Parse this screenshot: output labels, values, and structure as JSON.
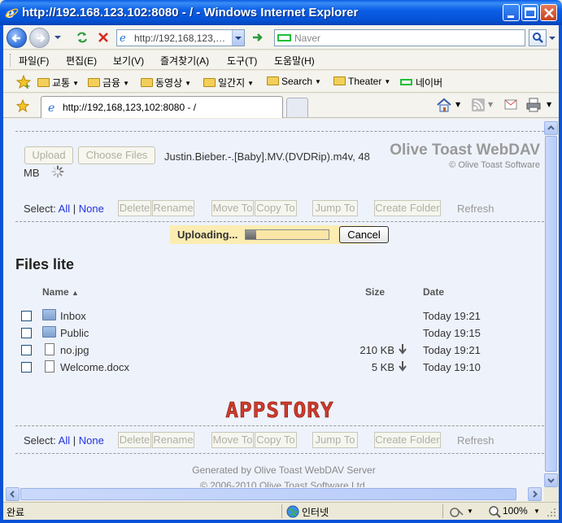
{
  "window": {
    "title": "http://192.168.123.102:8080 - / - Windows Internet Explorer"
  },
  "navbar": {
    "address": "http://192,168,123,…",
    "search_placeholder": "Naver"
  },
  "menu": {
    "items": [
      "파일(F)",
      "편집(E)",
      "보기(V)",
      "즐겨찾기(A)",
      "도구(T)",
      "도움말(H)"
    ]
  },
  "favorites": {
    "items": [
      {
        "label": "교통",
        "icon": "folder-icon"
      },
      {
        "label": "금융",
        "icon": "folder-icon"
      },
      {
        "label": "동영상",
        "icon": "folder-icon"
      },
      {
        "label": "일간지",
        "icon": "folder-icon"
      },
      {
        "label": "Search",
        "icon": "folder-icon"
      },
      {
        "label": "Theater",
        "icon": "folder-icon"
      },
      {
        "label": "네이버",
        "icon": "naver-icon"
      }
    ]
  },
  "tab": {
    "title": "http://192,168,123,102:8080 - /"
  },
  "page": {
    "upload_label": "Upload",
    "choose_files_label": "Choose Files",
    "selected_file_line1": "Justin.Bieber.-.[Baby].MV.(DVDRip).m4v, 48",
    "selected_file_line2": "MB",
    "brand": "Olive Toast WebDAV",
    "brand_sub": "© Olive Toast Software",
    "toolbar": {
      "select_label": "Select:",
      "all_label": "All",
      "divider": "|",
      "none_label": "None",
      "delete": "Delete",
      "rename": "Rename",
      "move_to": "Move To",
      "copy_to": "Copy To",
      "jump_to": "Jump To",
      "create_folder": "Create Folder",
      "refresh": "Refresh"
    },
    "uploading": {
      "label": "Uploading...",
      "progress": 0.13,
      "cancel_label": "Cancel"
    },
    "heading": "Files lite",
    "columns": {
      "name": "Name",
      "sort_indicator": "▲",
      "size": "Size",
      "date": "Date"
    },
    "files": [
      {
        "name": "Inbox",
        "type": "folder",
        "size": "",
        "date": "Today 19:21"
      },
      {
        "name": "Public",
        "type": "folder",
        "size": "",
        "date": "Today 19:15"
      },
      {
        "name": "no.jpg",
        "type": "file",
        "size": "210 KB",
        "date": "Today 19:21"
      },
      {
        "name": "Welcome.docx",
        "type": "file",
        "size": "5 KB",
        "date": "Today 19:10"
      }
    ],
    "logo_text": "APPSTORY",
    "footer_line1": "Generated by Olive Toast WebDAV Server",
    "footer_line2": "© 2006-2010 Olive Toast Software Ltd."
  },
  "statusbar": {
    "status": "완료",
    "zone": "인터넷",
    "zoom": "100%"
  },
  "colors": {
    "titlebar": "#0b5fe6",
    "content_bg": "#eef2fb",
    "upload_banner": "#fbedb2",
    "logo": "#d03a2a",
    "link": "#2233dd"
  }
}
